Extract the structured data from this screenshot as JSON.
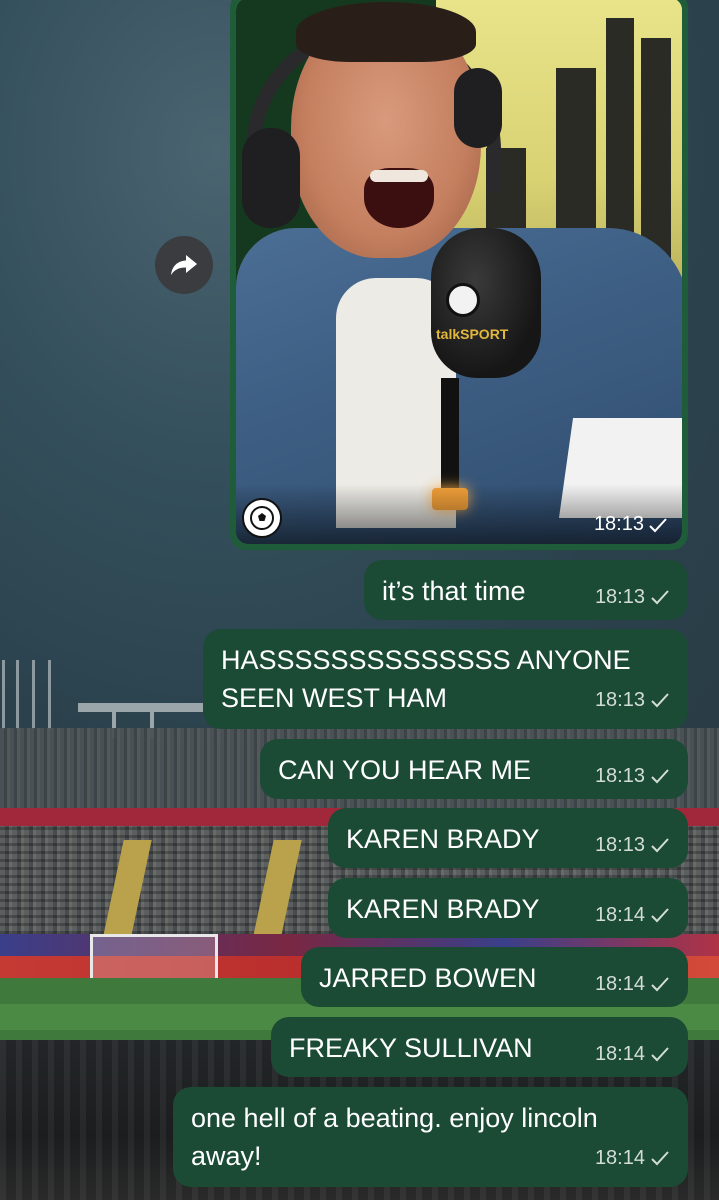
{
  "image_message": {
    "mic_brand": "talkSPORT",
    "time": "18:13",
    "status_icon": "single-check-icon"
  },
  "forward_button": {
    "icon": "forward-arrow-icon"
  },
  "messages": [
    {
      "text": "it’s that time",
      "time": "18:13",
      "status_icon": "single-check-icon"
    },
    {
      "text": "HASSSSSSSSSSSSSS ANYONE SEEN WEST HAM",
      "time": "18:13",
      "status_icon": "single-check-icon"
    },
    {
      "text": "CAN YOU HEAR ME",
      "time": "18:13",
      "status_icon": "single-check-icon"
    },
    {
      "text": "KAREN BRADY",
      "time": "18:13",
      "status_icon": "single-check-icon"
    },
    {
      "text": "KAREN BRADY",
      "time": "18:14",
      "status_icon": "single-check-icon"
    },
    {
      "text": "JARRED BOWEN",
      "time": "18:14",
      "status_icon": "single-check-icon"
    },
    {
      "text": "FREAKY SULLIVAN",
      "time": "18:14",
      "status_icon": "single-check-icon"
    },
    {
      "text": "one hell of a beating. enjoy lincoln away!",
      "time": "18:14",
      "status_icon": "single-check-icon"
    }
  ],
  "colors": {
    "outgoing_bubble": "#1b4a35",
    "image_bubble_border": "#1f5c3a",
    "text": "#ffffff",
    "meta": "#d3ddd7"
  }
}
